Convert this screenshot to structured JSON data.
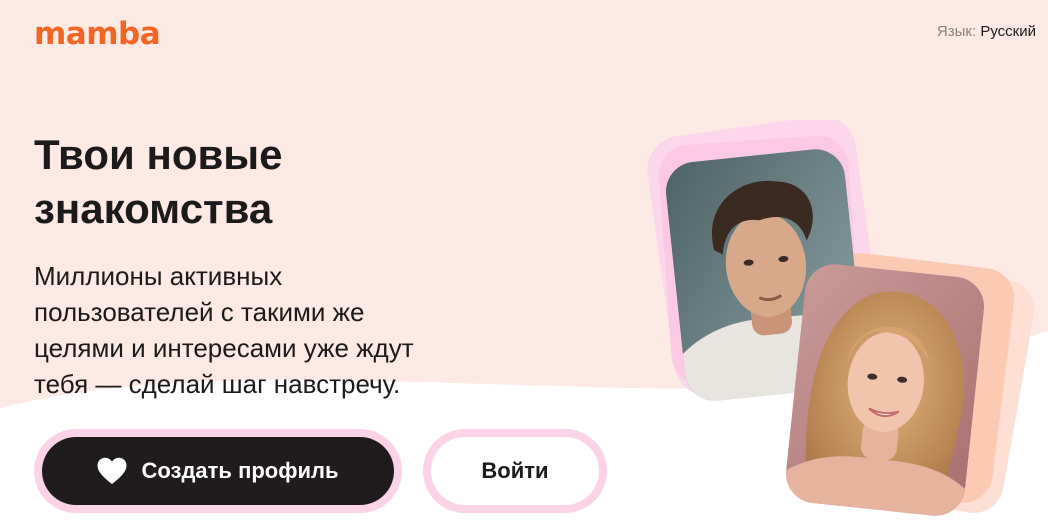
{
  "header": {
    "logo": "mamba",
    "language_label": "Язык:",
    "language_value": "Русский"
  },
  "hero": {
    "title_line1": "Твои новые",
    "title_line2": "знакомства",
    "subtitle_line1": "Миллионы активных",
    "subtitle_line2": "пользователей с такими же",
    "subtitle_line3": "целями и интересами уже ждут",
    "subtitle_line4": "тебя — сделай шаг навстречу."
  },
  "actions": {
    "create_profile_label": "Создать профиль",
    "login_label": "Войти"
  },
  "photos": {
    "man_photo": "profile-photo-man",
    "woman_photo": "profile-photo-woman"
  },
  "colors": {
    "brand": "#f26522",
    "hero_background": "#fdeae4",
    "primary_button": "#201c1d",
    "button_ring": "#fbd2e6"
  }
}
